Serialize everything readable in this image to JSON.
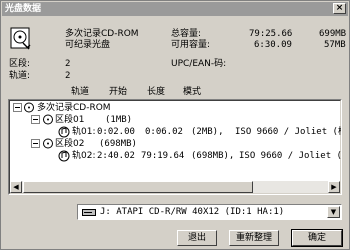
{
  "window": {
    "title": "光盘数据",
    "close_label": "×"
  },
  "disc": {
    "type_label": "多次记录CD-ROM",
    "status_label": "可纪录光盘",
    "total_capacity_label": "总容量:",
    "total_capacity_time": "79:25.66",
    "total_capacity_size": "699MB",
    "free_capacity_label": "可用容量:",
    "free_capacity_time": "6:30.09",
    "free_capacity_size": "57MB",
    "sessions_label": "区段:",
    "sessions_value": "2",
    "tracks_label": "轨道:",
    "tracks_value": "2",
    "upc_label": "UPC/EAN-码:"
  },
  "columns": [
    "轨道",
    "开始",
    "长度",
    "模式"
  ],
  "tree": {
    "root": "多次记录CD-ROM",
    "session1": {
      "label": "区段01",
      "size": "(1MB)"
    },
    "track1": {
      "label": "轨01:",
      "start": "0:02.00",
      "length": "0:06.02",
      "size": "(2MB),",
      "mode": "ISO 9660 / Joliet (模式"
    },
    "session2": {
      "label": "区段02",
      "size": "(698MB)"
    },
    "track2": {
      "label": "轨02:",
      "start": "2:40.02",
      "length": "79:19.64",
      "size": "(698MB),",
      "mode": "ISO 9660 / Joliet (模式"
    }
  },
  "drive": {
    "selected": "J: ATAPI    CD-R/RW 40X12  (ID:1  HA:1)"
  },
  "buttons": {
    "exit": "退出",
    "reorganize": "重新整理",
    "ok": "确定"
  }
}
